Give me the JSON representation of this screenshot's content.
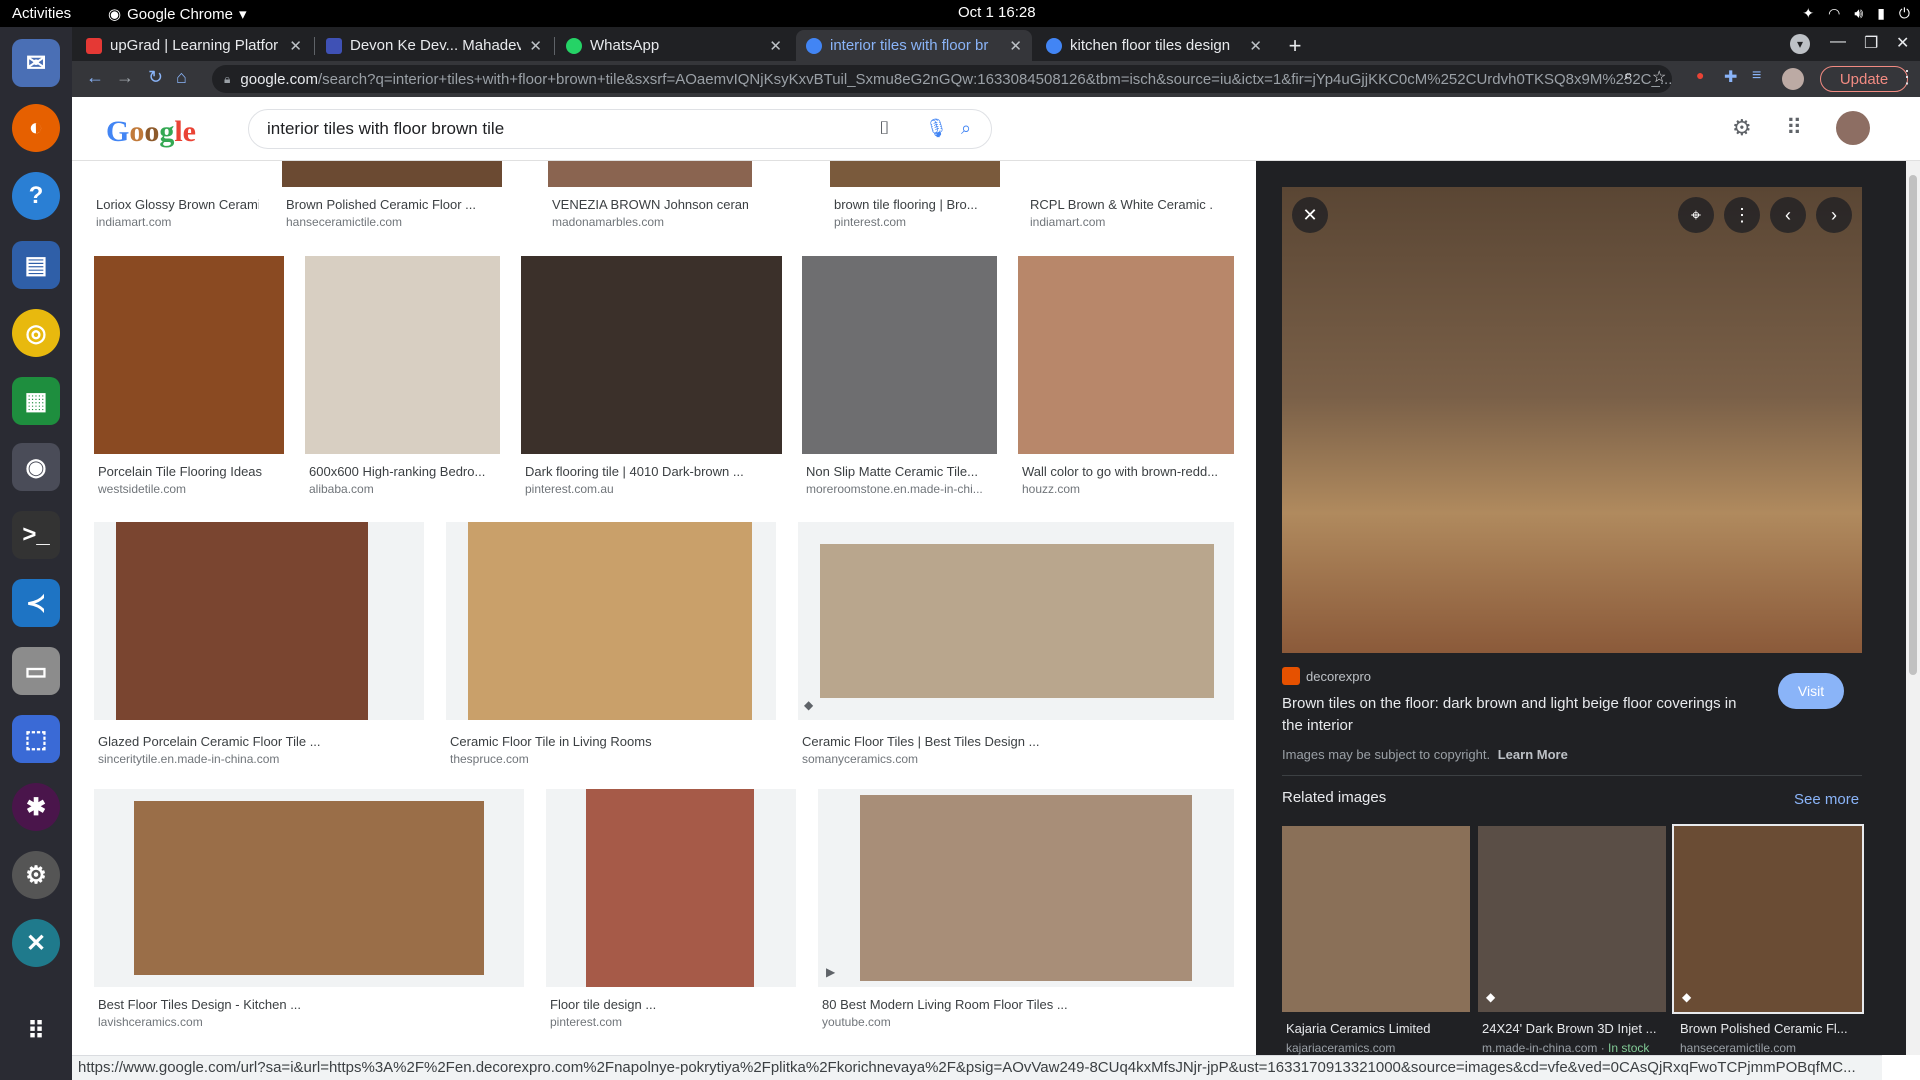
{
  "system": {
    "activities": "Activities",
    "app": "Google Chrome",
    "clock": "Oct 1  16:28"
  },
  "tabs": [
    {
      "label": "upGrad | Learning Platfor",
      "color": "#e53935"
    },
    {
      "label": "Devon Ke Dev... Mahadev",
      "color": "#3f51b5"
    },
    {
      "label": "WhatsApp",
      "color": "#25d366"
    },
    {
      "label": "interior tiles with floor br",
      "color": "#4285f4"
    },
    {
      "label": "kitchen floor tiles design",
      "color": "#4285f4"
    }
  ],
  "url": {
    "domain": "google.com",
    "rest": "/search?q=interior+tiles+with+floor+brown+tile&sxsrf=AOaemvIQNjKsyKxvBTuil_Sxmu8eG2nGQw:1633084508126&tbm=isch&source=iu&ictx=1&fir=jYp4uGjjKKC0cM%252CUrdvh0TKSQ8x9M%252C_..."
  },
  "update_label": "Update",
  "search": {
    "query": "interior tiles with floor brown tile"
  },
  "top_row": [
    {
      "title": "Loriox Glossy Brown Ceramic ...",
      "source": "indiamart.com"
    },
    {
      "title": "Brown Polished Ceramic Floor ...",
      "source": "hanseceramictile.com"
    },
    {
      "title": "VENEZIA BROWN Johnson ceramic floor ...",
      "source": "madonamarbles.com"
    },
    {
      "title": "brown tile flooring | Bro...",
      "source": "pinterest.com"
    },
    {
      "title": "RCPL Brown & White Ceramic ...",
      "source": "indiamart.com"
    }
  ],
  "row2": [
    {
      "title": "Porcelain Tile Flooring Ideas",
      "source": "westsidetile.com",
      "color": "#8a4a22"
    },
    {
      "title": "600x600 High-ranking Bedro...",
      "source": "alibaba.com",
      "color": "#d8cfc2"
    },
    {
      "title": "Dark flooring tile | 4010 Dark-brown ...",
      "source": "pinterest.com.au",
      "color": "#3b302a"
    },
    {
      "title": "Non Slip Matte Ceramic Tile...",
      "source": "moreroomstone.en.made-in-chi...",
      "color": "#6e6e70"
    },
    {
      "title": "Wall color to go with brown-redd...",
      "source": "houzz.com",
      "color": "#b8876a"
    }
  ],
  "row3": [
    {
      "title": "Glazed Porcelain Ceramic Floor Tile ...",
      "source": "sinceritytile.en.made-in-china.com",
      "color": "#7a4530"
    },
    {
      "title": "Ceramic Floor Tile in Living Rooms",
      "source": "thespruce.com",
      "color": "#c9a06a"
    },
    {
      "title": "Ceramic Floor Tiles | Best Tiles Design ...",
      "source": "somanyceramics.com",
      "color": "#b9a68d"
    }
  ],
  "row4": [
    {
      "title": "Best Floor Tiles Design - Kitchen ...",
      "source": "lavishceramics.com",
      "color": "#9a6e48"
    },
    {
      "title": "Floor tile design ...",
      "source": "pinterest.com",
      "color": "#a65a48"
    },
    {
      "title": "80 Best Modern Living Room Floor Tiles ...",
      "source": "youtube.com",
      "color": "#a88e78"
    }
  ],
  "panel": {
    "site": "decorexpro",
    "title": "Brown tiles on the floor: dark brown and light beige floor coverings in the interior",
    "visit": "Visit",
    "copyright": "Images may be subject to copyright.",
    "learn_more": "Learn More",
    "related": "Related images",
    "see_more": "See more",
    "related_items": [
      {
        "title": "Kajaria Ceramics Limited",
        "source": "kajariaceramics.com",
        "stock": "",
        "color": "#8a7058"
      },
      {
        "title": "24X24' Dark Brown 3D Injet ...",
        "source": "m.made-in-china.com",
        "stock": "In stock",
        "color": "#5a4e46"
      },
      {
        "title": "Brown Polished Ceramic Fl...",
        "source": "hanseceramictile.com",
        "stock": "",
        "color": "#6a4c34"
      }
    ]
  },
  "status_url": "https://www.google.com/url?sa=i&url=https%3A%2F%2Fen.decorexpro.com%2Fnapolnye-pokrytiya%2Fplitka%2Fkorichnevaya%2F&psig=AOvVaw249-8CUq4kxMfsJNjr-jpP&ust=1633170913321000&source=images&cd=vfe&ved=0CAsQjRxqFwoTCPjmmPOBqfMC..."
}
